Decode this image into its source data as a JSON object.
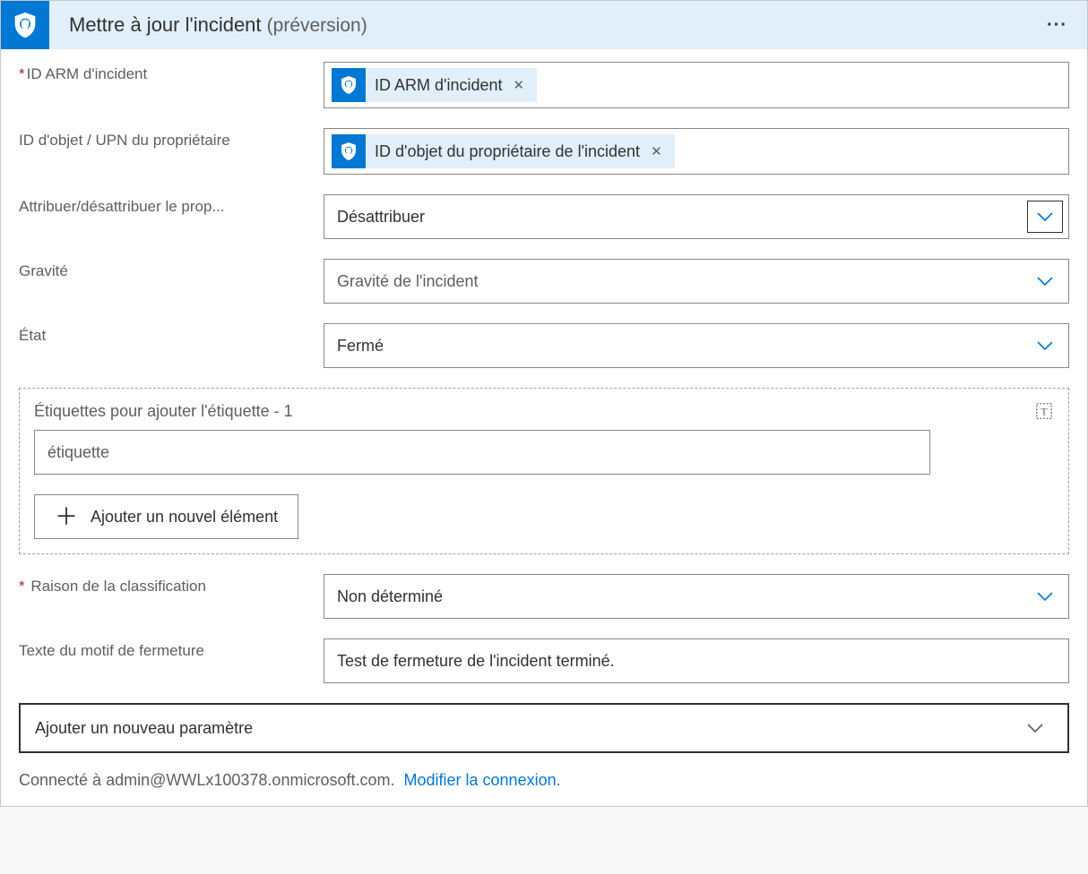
{
  "header": {
    "title": "Mettre à jour l'incident",
    "suffix": "(préversion)"
  },
  "fields": {
    "arm_id": {
      "label": "ID ARM d'incident",
      "token": "ID ARM d'incident"
    },
    "owner_upn": {
      "label": "ID d'objet / UPN du propriétaire",
      "token": "ID d'objet du propriétaire de l'incident"
    },
    "assign": {
      "label": "Attribuer/désattribuer le prop...",
      "value": "Désattribuer"
    },
    "severity": {
      "label": "Gravité",
      "placeholder": "Gravité de l'incident"
    },
    "state": {
      "label": "État",
      "value": "Fermé"
    },
    "tags": {
      "title": "Étiquettes pour ajouter l'étiquette - 1",
      "placeholder": "étiquette",
      "add_button": "Ajouter un nouvel élément"
    },
    "classification": {
      "label": "Raison de la classification",
      "value": "Non déterminé"
    },
    "close_reason": {
      "label": "Texte du motif de fermeture",
      "value": "Test de fermeture de l'incident terminé."
    },
    "add_param": {
      "label": "Ajouter un nouveau paramètre"
    }
  },
  "footer": {
    "connected_prefix": "Connecté à ",
    "account": "admin@WWLx100378.onmicrosoft.com.",
    "change_link": "Modifier la connexion."
  }
}
